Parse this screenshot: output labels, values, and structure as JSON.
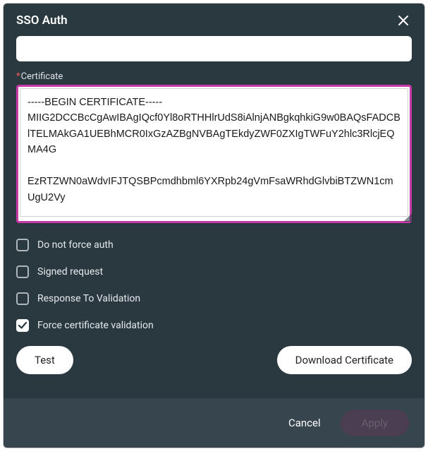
{
  "header": {
    "title": "SSO Auth"
  },
  "fields": {
    "certificate": {
      "label": "Certificate",
      "required_marker": "*",
      "value": "-----BEGIN CERTIFICATE-----\nMIIG2DCCBcCgAwIBAgIQcf0Yl8oRTHHlrUdS8iAlnjANBgkqhkiG9w0BAQsFADCB\nlTELMAkGA1UEBhMCR0IxGzAZBgNVBAgTEkdyZWF0ZXIgTWFuY2hlc3RlcjEQMA4G\n                                                                                                                                              \nEzRTZWN0aWdvIFJTQSBPcmdhbml6YXRpb24gVmFsaWRhdGlvbiBTZWN1cmUgU2Vy"
    }
  },
  "checkboxes": {
    "no_force_auth": {
      "label": "Do not force auth",
      "checked": false
    },
    "signed_request": {
      "label": "Signed request",
      "checked": false
    },
    "response_to_validation": {
      "label": "Response To Validation",
      "checked": false
    },
    "force_cert_validation": {
      "label": "Force certificate validation",
      "checked": true
    }
  },
  "buttons": {
    "test": "Test",
    "download_cert": "Download Certificate"
  },
  "footer": {
    "cancel": "Cancel",
    "apply": "Apply"
  }
}
